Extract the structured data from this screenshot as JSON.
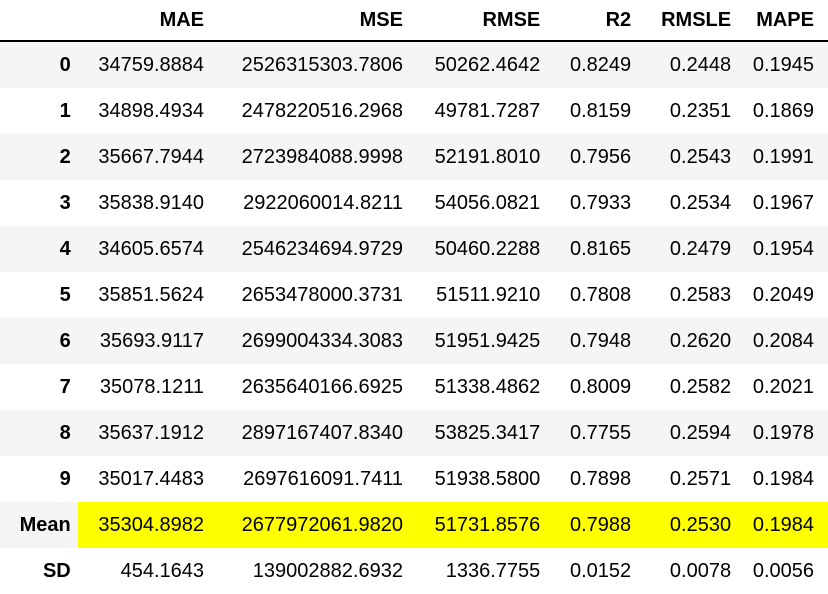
{
  "table": {
    "columns": [
      "",
      "MAE",
      "MSE",
      "RMSE",
      "R2",
      "RMSLE",
      "MAPE"
    ],
    "rows": [
      {
        "index": "0",
        "values": [
          "34759.8884",
          "2526315303.7806",
          "50262.4642",
          "0.8249",
          "0.2448",
          "0.1945"
        ]
      },
      {
        "index": "1",
        "values": [
          "34898.4934",
          "2478220516.2968",
          "49781.7287",
          "0.8159",
          "0.2351",
          "0.1869"
        ]
      },
      {
        "index": "2",
        "values": [
          "35667.7944",
          "2723984088.9998",
          "52191.8010",
          "0.7956",
          "0.2543",
          "0.1991"
        ]
      },
      {
        "index": "3",
        "values": [
          "35838.9140",
          "2922060014.8211",
          "54056.0821",
          "0.7933",
          "0.2534",
          "0.1967"
        ]
      },
      {
        "index": "4",
        "values": [
          "34605.6574",
          "2546234694.9729",
          "50460.2288",
          "0.8165",
          "0.2479",
          "0.1954"
        ]
      },
      {
        "index": "5",
        "values": [
          "35851.5624",
          "2653478000.3731",
          "51511.9210",
          "0.7808",
          "0.2583",
          "0.2049"
        ]
      },
      {
        "index": "6",
        "values": [
          "35693.9117",
          "2699004334.3083",
          "51951.9425",
          "0.7948",
          "0.2620",
          "0.2084"
        ]
      },
      {
        "index": "7",
        "values": [
          "35078.1211",
          "2635640166.6925",
          "51338.4862",
          "0.8009",
          "0.2582",
          "0.2021"
        ]
      },
      {
        "index": "8",
        "values": [
          "35637.1912",
          "2897167407.8340",
          "53825.3417",
          "0.7755",
          "0.2594",
          "0.1978"
        ]
      },
      {
        "index": "9",
        "values": [
          "35017.4483",
          "2697616091.7411",
          "51938.5800",
          "0.7898",
          "0.2571",
          "0.1984"
        ]
      },
      {
        "index": "Mean",
        "values": [
          "35304.8982",
          "2677972061.9820",
          "51731.8576",
          "0.7988",
          "0.2530",
          "0.1984"
        ],
        "highlight": true
      },
      {
        "index": "SD",
        "values": [
          "454.1643",
          "139002882.6932",
          "1336.7755",
          "0.0152",
          "0.0078",
          "0.0056"
        ]
      }
    ],
    "highlight_color": "#ffff00"
  }
}
